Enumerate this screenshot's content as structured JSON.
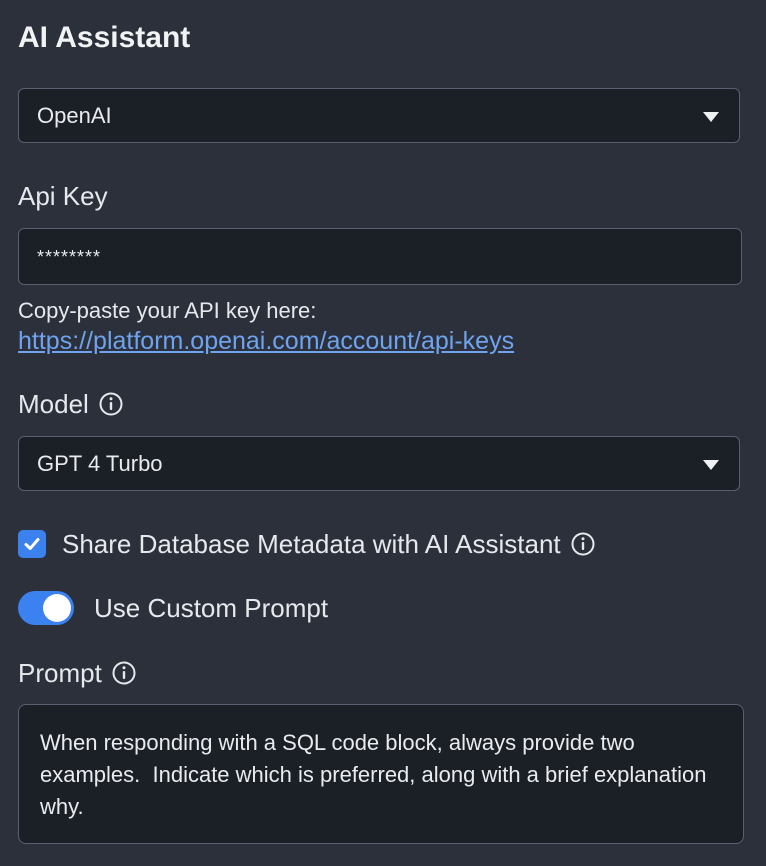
{
  "title": "AI Assistant",
  "provider": {
    "selected": "OpenAI"
  },
  "api_key": {
    "label": "Api Key",
    "value": "********",
    "hint": "Copy-paste your API key here:",
    "link": "https://platform.openai.com/account/api-keys"
  },
  "model": {
    "label": "Model",
    "selected": "GPT 4 Turbo"
  },
  "share_metadata": {
    "label": "Share Database Metadata with AI Assistant",
    "checked": true
  },
  "custom_prompt": {
    "label": "Use Custom Prompt",
    "enabled": true
  },
  "prompt": {
    "label": "Prompt",
    "value": "When responding with a SQL code block, always provide two examples.  Indicate which is preferred, along with a brief explanation why."
  },
  "icons": {
    "info": "info-icon",
    "caret": "chevron-down-icon",
    "check": "check-icon"
  },
  "colors": {
    "background": "#2b303b",
    "field_background": "#1b2027",
    "accent": "#3b82f0",
    "link": "#6fa3ee",
    "border": "#586070"
  }
}
